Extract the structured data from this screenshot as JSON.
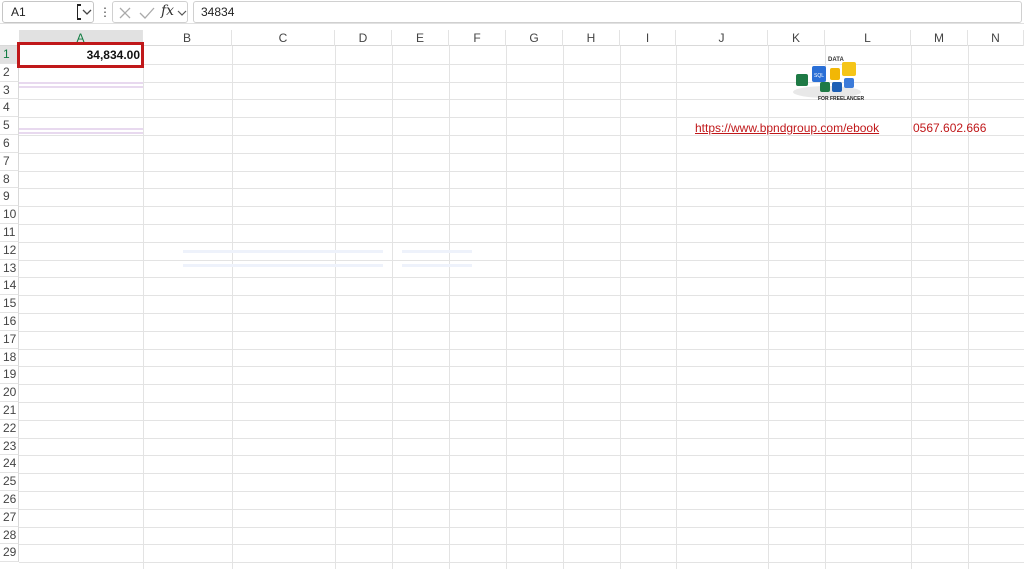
{
  "formula_bar": {
    "name_box": "A1",
    "formula": "34834",
    "fx_label": "fx"
  },
  "columns": [
    "A",
    "B",
    "C",
    "D",
    "E",
    "F",
    "G",
    "H",
    "I",
    "J",
    "K",
    "L",
    "M",
    "N"
  ],
  "rows": [
    "1",
    "2",
    "3",
    "4",
    "5",
    "6",
    "7",
    "8",
    "9",
    "10",
    "11",
    "12",
    "13",
    "14",
    "15",
    "16",
    "17",
    "18",
    "19",
    "20",
    "21",
    "22",
    "23",
    "24",
    "25",
    "26",
    "27",
    "28",
    "29"
  ],
  "cells": {
    "A1": "34,834.00",
    "J5": "https://www.bpndgroup.com/ebook",
    "M5": "0567.602.666"
  },
  "logo": {
    "top_text": "DATA",
    "sql_text": "SQL",
    "bottom_text": "FOR FREELANCER"
  },
  "colors": {
    "active_border": "#c0181a",
    "link": "#c0181a",
    "header_select": "#107c41"
  }
}
